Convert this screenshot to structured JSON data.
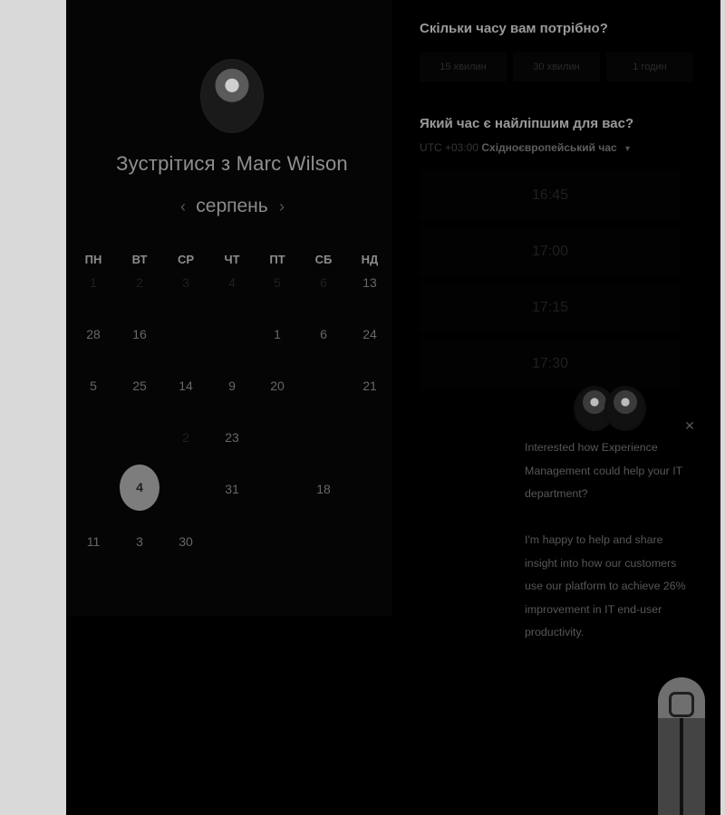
{
  "calendar": {
    "title": "Зустрітися з Marc Wilson",
    "month": "серпень",
    "weekdays": [
      "ПН",
      "ВТ",
      "СР",
      "ЧТ",
      "ПТ",
      "СБ",
      "НД"
    ],
    "rows": [
      [
        "1",
        "2",
        "3",
        "4",
        "5",
        "6",
        "13"
      ],
      [
        "28",
        "16",
        "",
        "",
        "1",
        "6",
        "24"
      ],
      [
        "5",
        "25",
        "14",
        "9",
        "20",
        "",
        "21"
      ],
      [
        "",
        "",
        "2",
        "23",
        "",
        "",
        ""
      ],
      [
        "",
        "4",
        "",
        "31",
        "",
        "18",
        ""
      ],
      [
        "11",
        "3",
        "30",
        "",
        "",
        "",
        ""
      ]
    ],
    "selected_day": "4"
  },
  "booking": {
    "duration_question": "Скільки часу вам потрібно?",
    "durations": [
      "15 хвилин",
      "30 хвилин",
      "1 годин"
    ],
    "time_question": "Який час є найліпшим для вас?",
    "timezone_offset": "UTC +03:00",
    "timezone_name": "Східноєвропейський час",
    "time_slots": [
      "16:45",
      "17:00",
      "17:15",
      "17:30"
    ]
  },
  "chat": {
    "lines": [
      "Interested how Experience",
      "Management could help your IT",
      "department?",
      "",
      "I'm happy to help and share",
      "insight into how our customers",
      "use our platform to achieve 26%",
      "improvement in IT end-user",
      "productivity."
    ]
  }
}
